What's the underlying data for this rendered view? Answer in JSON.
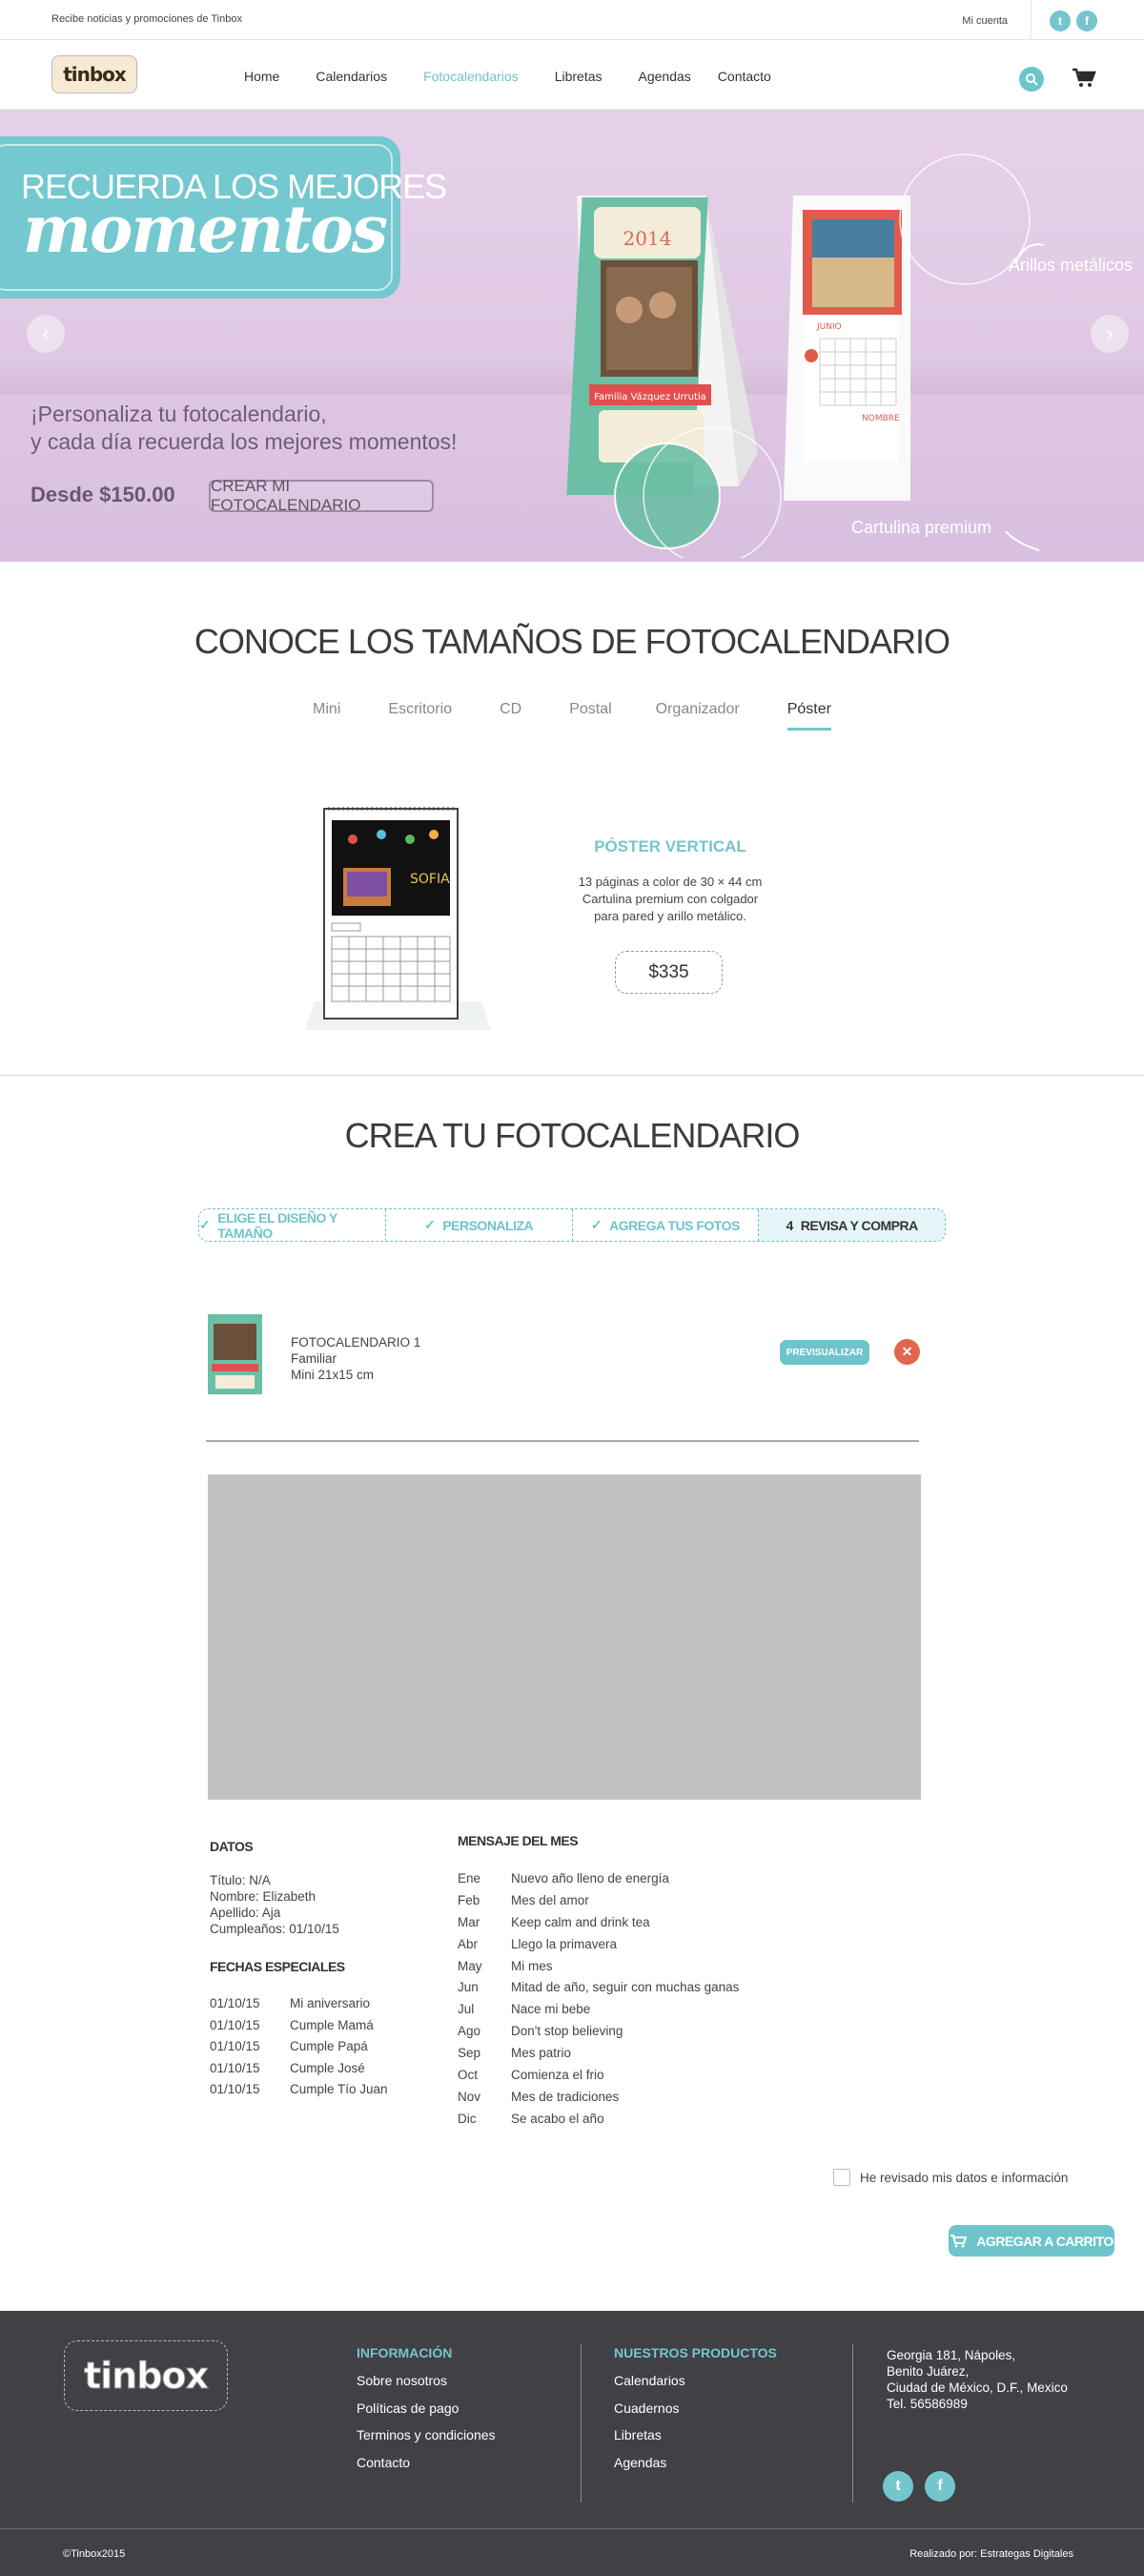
{
  "topbar": {
    "promo": "Recibe noticias y promociones de Tinbox",
    "account": "Mi cuenta",
    "social": [
      {
        "icon": "twitter-icon",
        "glyph": "t"
      },
      {
        "icon": "facebook-icon",
        "glyph": "f"
      }
    ]
  },
  "nav": {
    "logo": "tinbox",
    "links": [
      "Home",
      "Calendarios",
      "Fotocalendarios",
      "Libretas",
      "Agendas",
      "Contacto"
    ],
    "active_index": 2
  },
  "hero": {
    "title_line1": "RECUERDA LOS MEJORES",
    "title_line2": "momentos",
    "subtitle_line1": "¡Personaliza tu fotocalendario,",
    "subtitle_line2": "y cada día recuerda los mejores momentos!",
    "price": "Desde $150.00",
    "cta": "CREAR MI FOTOCALENDARIO",
    "annotation_rings": "Arillos metálicos",
    "annotation_paper": "Cartulina premium",
    "calendar1_year": "2014",
    "calendar1_banner": "Familia Vázquez Urrutia",
    "calendar2_month": "JUNIO",
    "calendar2_name": "NOMBRE"
  },
  "sizes": {
    "title": "CONOCE LOS TAMAÑOS DE FOTOCALENDARIO",
    "tabs": [
      "Mini",
      "Escritorio",
      "CD",
      "Postal",
      "Organizador",
      "Póster"
    ],
    "active_tab": 5,
    "product_title": "PÓSTER VERTICAL",
    "product_desc_1": "13 páginas a color de 30 × 44 cm",
    "product_desc_2": "Cartulina premium con colgador",
    "product_desc_3": "para pared y arillo metálico.",
    "price": "$335",
    "poster_label": "SOFIA"
  },
  "create": {
    "title": "CREA TU FOTOCALENDARIO",
    "steps": [
      {
        "label": "ELIGE EL DISEÑO Y TAMAÑO",
        "prefix": "✓"
      },
      {
        "label": "PERSONALIZA",
        "prefix": "✓"
      },
      {
        "label": "AGREGA TUS FOTOS",
        "prefix": "✓"
      },
      {
        "label": "REVISA Y COMPRA",
        "prefix": "4"
      }
    ],
    "item": {
      "name": "FOTOCALENDARIO 1",
      "theme": "Familiar",
      "size": "Mini 21x15 cm",
      "preview_label": "PREVISUALIZAR",
      "remove_glyph": "✕"
    }
  },
  "datos": {
    "title": "DATOS",
    "lines": [
      "Título: N/A",
      "Nombre: Elizabeth",
      "Apellido: Aja",
      "Cumpleaños: 01/10/15"
    ]
  },
  "fechas": {
    "title": "FECHAS ESPECIALES",
    "rows": [
      {
        "date": "01/10/15",
        "label": "Mi aniversario"
      },
      {
        "date": "01/10/15",
        "label": "Cumple Mamá"
      },
      {
        "date": "01/10/15",
        "label": "Cumple Papá"
      },
      {
        "date": "01/10/15",
        "label": "Cumple José"
      },
      {
        "date": "01/10/15",
        "label": "Cumple Tío Juan"
      }
    ]
  },
  "mensajes": {
    "title": "MENSAJE DEL MES",
    "rows": [
      {
        "month": "Ene",
        "text": "Nuevo año lleno de energía"
      },
      {
        "month": "Feb",
        "text": "Mes del amor"
      },
      {
        "month": "Mar",
        "text": "Keep calm and drink tea"
      },
      {
        "month": "Abr",
        "text": "Llego la primavera"
      },
      {
        "month": "May",
        "text": "Mi mes"
      },
      {
        "month": "Jun",
        "text": "Mitad de año, seguir con muchas ganas"
      },
      {
        "month": "Jul",
        "text": "Nace mi bebe"
      },
      {
        "month": "Ago",
        "text": "Don't stop believing"
      },
      {
        "month": "Sep",
        "text": "Mes patrio"
      },
      {
        "month": "Oct",
        "text": "Comienza el frio"
      },
      {
        "month": "Nov",
        "text": "Mes de tradiciones"
      },
      {
        "month": "Dic",
        "text": "Se acabo el año"
      }
    ]
  },
  "checkout": {
    "confirm_label": "He revisado mis datos e información",
    "add_to_cart": "AGREGAR A CARRITO"
  },
  "footer": {
    "logo": "tinbox",
    "info_title": "INFORMACIÓN",
    "info_links": [
      "Sobre nosotros",
      "Políticas de pago",
      "Terminos y condiciones",
      "Contacto"
    ],
    "products_title": "NUESTROS PRODUCTOS",
    "products_links": [
      "Calendarios",
      "Cuadernos",
      "Libretas",
      "Agendas"
    ],
    "address": [
      "Georgia 181, Nápoles,",
      "Benito Juárez,",
      "Ciudad de México, D.F., Mexico",
      "Tel. 56586989"
    ],
    "copyright": "©Tinbox2015",
    "made_by": "Realizado por: Estrategas Digitales"
  },
  "colors": {
    "accent": "#6ec4cb",
    "hero_bg": "#e2cbe6",
    "danger": "#e2664d",
    "footer_bg": "#414045"
  }
}
